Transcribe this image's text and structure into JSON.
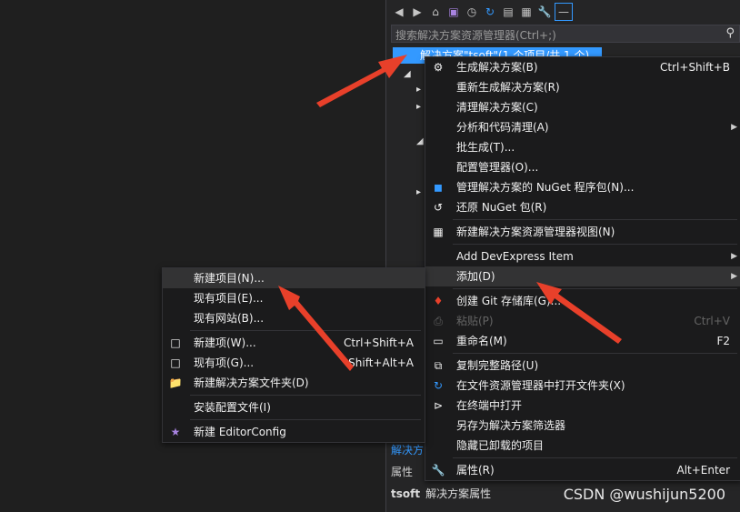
{
  "explorer": {
    "search_placeholder": "搜索解决方案资源管理器(Ctrl+;)",
    "root_label": "解决方案\"tsoft\"(1 个项目/共 1 个)",
    "bottom_tab": "解决方",
    "properties_label": "属性",
    "properties_name": "tsoft",
    "properties_type": "解决方案属性",
    "toolbar_icons": [
      "back-icon",
      "forward-icon",
      "home-icon",
      "vs-icon",
      "history-icon",
      "sync-icon",
      "collapse-icon",
      "show-all-icon",
      "wrench-icon",
      "pin-icon"
    ]
  },
  "main_menu": [
    {
      "label": "生成解决方案(B)",
      "shortcut": "Ctrl+Shift+B",
      "icon": "build-icon"
    },
    {
      "label": "重新生成解决方案(R)"
    },
    {
      "label": "清理解决方案(C)"
    },
    {
      "label": "分析和代码清理(A)",
      "submenu": true
    },
    {
      "label": "批生成(T)..."
    },
    {
      "label": "配置管理器(O)..."
    },
    {
      "label": "管理解决方案的 NuGet 程序包(N)...",
      "icon": "nuget-icon"
    },
    {
      "label": "还原 NuGet 包(R)",
      "icon": "restore-icon"
    },
    {
      "sep": true
    },
    {
      "label": "新建解决方案资源管理器视图(N)",
      "icon": "new-view-icon"
    },
    {
      "sep": true
    },
    {
      "label": "Add DevExpress Item",
      "submenu": true
    },
    {
      "label": "添加(D)",
      "submenu": true,
      "highlight": true
    },
    {
      "sep": true
    },
    {
      "label": "创建 Git 存储库(G)...",
      "icon": "git-icon"
    },
    {
      "label": "粘贴(P)",
      "shortcut": "Ctrl+V",
      "disabled": true,
      "icon": "paste-icon"
    },
    {
      "label": "重命名(M)",
      "shortcut": "F2",
      "icon": "rename-icon"
    },
    {
      "sep": true
    },
    {
      "label": "复制完整路径(U)",
      "icon": "copy-icon"
    },
    {
      "label": "在文件资源管理器中打开文件夹(X)",
      "icon": "open-folder-icon"
    },
    {
      "label": "在终端中打开",
      "icon": "terminal-icon"
    },
    {
      "label": "另存为解决方案筛选器"
    },
    {
      "label": "隐藏已卸载的项目"
    },
    {
      "sep": true
    },
    {
      "label": "属性(R)",
      "shortcut": "Alt+Enter",
      "icon": "wrench-icon"
    }
  ],
  "sub_menu": [
    {
      "label": "新建项目(N)...",
      "highlight": true
    },
    {
      "label": "现有项目(E)..."
    },
    {
      "label": "现有网站(B)..."
    },
    {
      "sep": true
    },
    {
      "label": "新建项(W)...",
      "shortcut": "Ctrl+Shift+A",
      "icon": "new-item-icon"
    },
    {
      "label": "现有项(G)...",
      "shortcut": "Shift+Alt+A",
      "icon": "existing-item-icon"
    },
    {
      "label": "新建解决方案文件夹(D)",
      "icon": "solution-folder-icon"
    },
    {
      "sep": true
    },
    {
      "label": "安装配置文件(I)"
    },
    {
      "sep": true
    },
    {
      "label": "新建 EditorConfig",
      "icon": "editorconfig-icon"
    }
  ],
  "watermark": "CSDN @wushijun5200",
  "colors": {
    "accent": "#3399ff",
    "arrow": "#e8402a",
    "menu_bg": "#1b1b1c"
  }
}
